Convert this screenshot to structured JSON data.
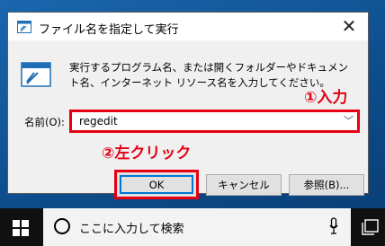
{
  "dialog": {
    "title": "ファイル名を指定して実行",
    "description": "実行するプログラム名、または開くフォルダーやドキュメント名、インターネット リソース名を入力してください。",
    "name_label": "名前(O):",
    "name_value": "regedit",
    "buttons": {
      "ok": "OK",
      "cancel": "キャンセル",
      "browse": "参照(B)..."
    }
  },
  "annotations": {
    "step1": "①入力",
    "step2": "②左クリック"
  },
  "taskbar": {
    "search_placeholder": "ここに入力して検索"
  },
  "colors": {
    "annotation": "#e60012",
    "focus": "#0078d7",
    "desktop": "#0e4f8e",
    "taskbar": "#101010"
  },
  "icons": [
    "run-app-icon",
    "close-icon",
    "chevron-down-icon",
    "windows-start-icon",
    "search-icon",
    "microphone-icon",
    "task-view-icon"
  ]
}
